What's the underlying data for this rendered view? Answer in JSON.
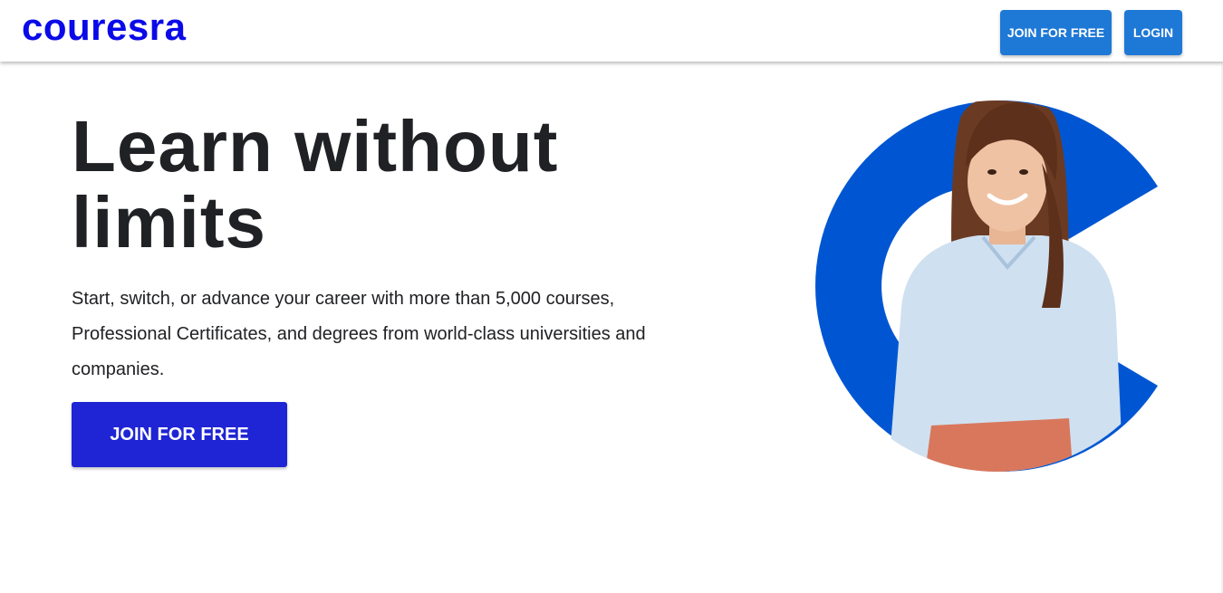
{
  "nav": {
    "logo": "couresra",
    "join_label": "JOIN FOR FREE",
    "login_label": "LOGIN"
  },
  "hero": {
    "title_line1": "Learn without",
    "title_line2": "limits",
    "subtitle": "Start, switch, or advance your career with more than 5,000 courses, Professional Certificates, and degrees from world-class universities and companies.",
    "cta_label": "JOIN FOR FREE",
    "image_icon": "smiling-woman-photo"
  },
  "colors": {
    "logo": "#0a0ae8",
    "nav_button": "#1e78d6",
    "cta_button": "#1f24d4",
    "brand_blue": "#0056d2",
    "text": "#202124"
  }
}
